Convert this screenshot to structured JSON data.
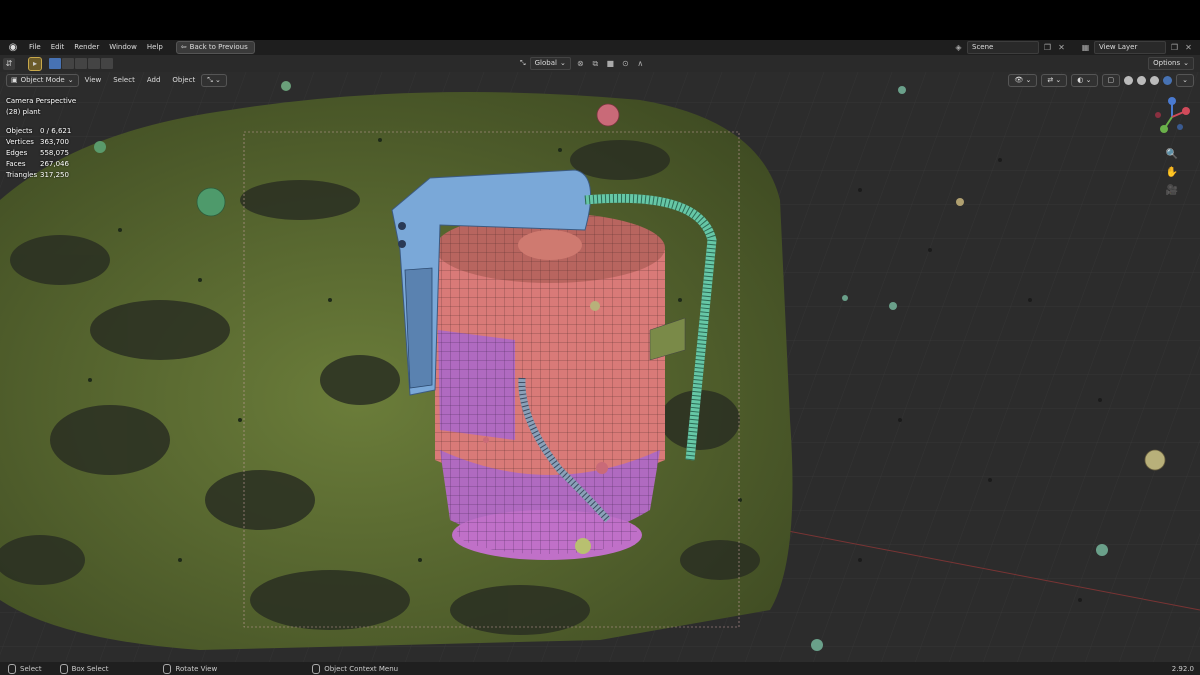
{
  "menu": {
    "items": [
      "File",
      "Edit",
      "Render",
      "Window",
      "Help"
    ],
    "back_button": "Back to Previous"
  },
  "scene": {
    "label": "Scene",
    "view_layer": "View Layer"
  },
  "toolbar": {
    "transform_orientation": "Global",
    "options": "Options"
  },
  "header": {
    "mode": "Object Mode",
    "menus": [
      "View",
      "Select",
      "Add",
      "Object"
    ]
  },
  "viewport": {
    "title": "Camera Perspective",
    "collection": "(28) plant"
  },
  "stats": [
    {
      "label": "Objects",
      "value": "0 / 6,621"
    },
    {
      "label": "Vertices",
      "value": "363,700"
    },
    {
      "label": "Edges",
      "value": "558,075"
    },
    {
      "label": "Faces",
      "value": "267,046"
    },
    {
      "label": "Triangles",
      "value": "317,250"
    }
  ],
  "statusbar": {
    "select": "Select",
    "box_select": "Box Select",
    "rotate": "Rotate View",
    "context_menu": "Object Context Menu",
    "version": "2.92.0"
  },
  "colors": {
    "terrain": "#4a5a2a",
    "pink": "#d97a78",
    "purple": "#b06ac0",
    "blue": "#7aa8d8",
    "teal": "#66c7a6",
    "accent": "#4772b3"
  }
}
